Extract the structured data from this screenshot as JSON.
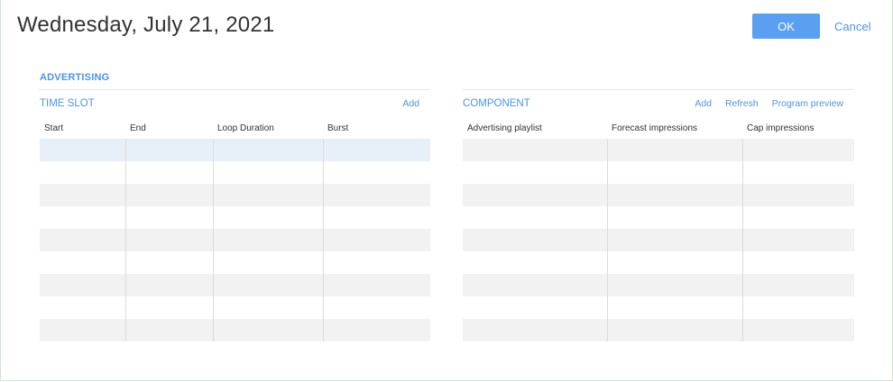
{
  "header": {
    "date": "Wednesday, July 21, 2021",
    "ok_label": "OK",
    "cancel_label": "Cancel"
  },
  "section": {
    "title": "ADVERTISING"
  },
  "time_slot": {
    "title": "TIME SLOT",
    "add_label": "Add",
    "columns": [
      "Start",
      "End",
      "Loop Duration",
      "Burst"
    ]
  },
  "component": {
    "title": "COMPONENT",
    "add_label": "Add",
    "refresh_label": "Refresh",
    "preview_label": "Program preview",
    "columns": [
      "Advertising playlist",
      "Forecast impressions",
      "Cap impressions"
    ]
  },
  "colors": {
    "accent": "#4b94e6",
    "ok_button": "#5aa0f2",
    "row_stripe": "#f2f2f2",
    "row_selected": "#e7eff8"
  }
}
